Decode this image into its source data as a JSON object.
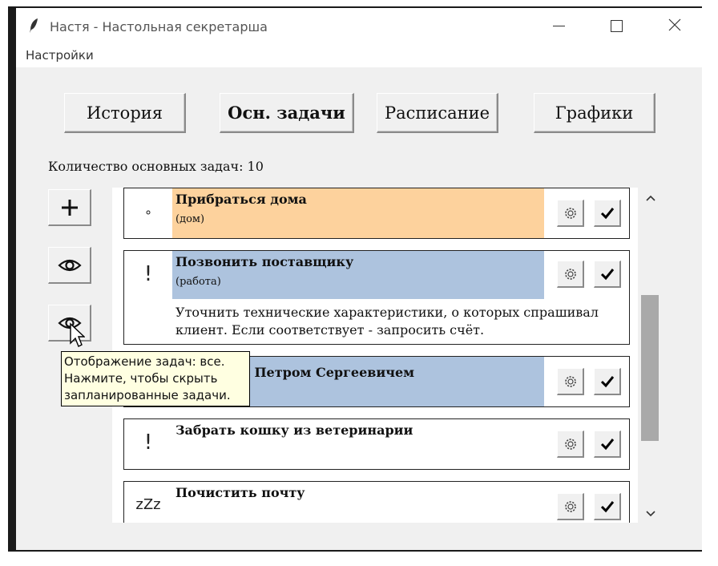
{
  "window": {
    "title": "Настя - Настольная секретарша",
    "icon": "feather-icon"
  },
  "menu": {
    "settings": "Настройки"
  },
  "tabs": [
    {
      "label": "История",
      "active": false
    },
    {
      "label": "Осн. задачи",
      "active": true
    },
    {
      "label": "Расписание",
      "active": false
    },
    {
      "label": "Графики",
      "active": false
    }
  ],
  "task_count_label": "Количество основных задач: 10",
  "side_buttons": [
    {
      "icon": "plus-icon"
    },
    {
      "icon": "eye-icon"
    },
    {
      "icon": "eye-icon"
    }
  ],
  "tasks": [
    {
      "title": "Прибраться дома",
      "category": "(дом)",
      "priority": "∘",
      "color": "#fdd29d",
      "description": ""
    },
    {
      "title": "Позвонить поставщику",
      "category": "(работа)",
      "priority": "!",
      "color": "#adc3de",
      "description_lines": [
        "Уточнить технические характеристики, о которых спрашивал",
        "клиент. Если соответствует - запросить счёт."
      ]
    },
    {
      "title": "ся с Петром Сергеевичем",
      "category": "",
      "priority": "",
      "color": "#adc3de",
      "description": ""
    },
    {
      "title": "Забрать кошку из ветеринарии",
      "category": "",
      "priority": "!",
      "color": "#ffffff",
      "description": ""
    },
    {
      "title": "Почистить почту",
      "category": "",
      "priority": "zZz",
      "color": "#ffffff",
      "description": ""
    }
  ],
  "tooltip": {
    "lines": [
      "Отображение задач: все.",
      "Нажмите, чтобы скрыть",
      "запланированные задачи."
    ]
  },
  "colors": {
    "home": "#fdd29d",
    "work": "#adc3de",
    "tooltip_bg": "#ffffe1",
    "scroll_thumb": "#a9a9a9"
  }
}
